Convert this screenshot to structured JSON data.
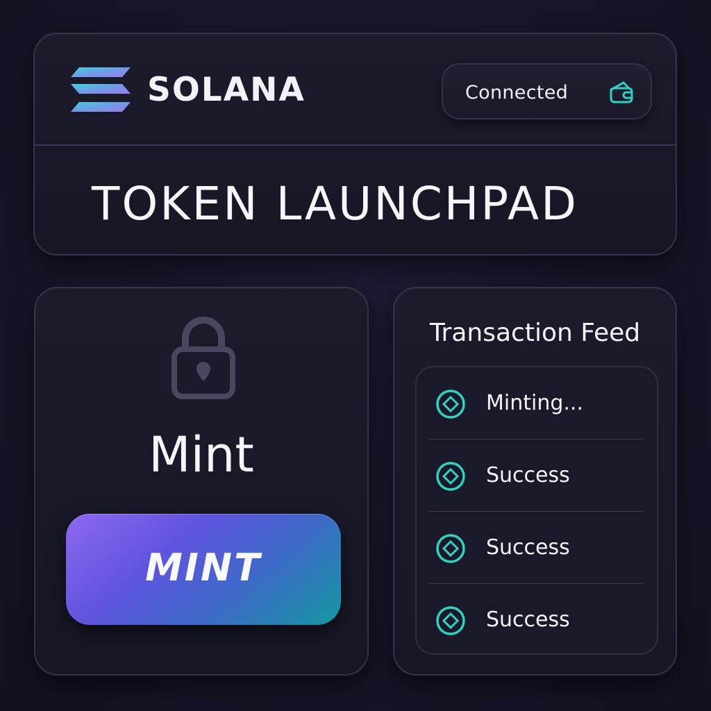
{
  "header": {
    "brand": "SOLANA",
    "wallet_status": "Connected",
    "page_title": "TOKEN LAUNCHPAD"
  },
  "mint_panel": {
    "heading": "Mint",
    "button_label": "MINT"
  },
  "feed": {
    "title": "Transaction Feed",
    "items": [
      {
        "label": "Minting...",
        "icon": "diamond-circle-icon"
      },
      {
        "label": "Success",
        "icon": "diamond-circle-icon"
      },
      {
        "label": "Success",
        "icon": "diamond-circle-icon"
      },
      {
        "label": "Success",
        "icon": "diamond-circle-icon"
      }
    ]
  },
  "icons": {
    "logo": "solana-logo-icon",
    "wallet": "wallet-icon",
    "lock": "lock-icon"
  },
  "colors": {
    "background": "#161528",
    "card": "#1b1a2b",
    "accent_teal": "#2ed3c4",
    "accent_purple": "#8e68f0",
    "text": "#f4f4f8"
  }
}
